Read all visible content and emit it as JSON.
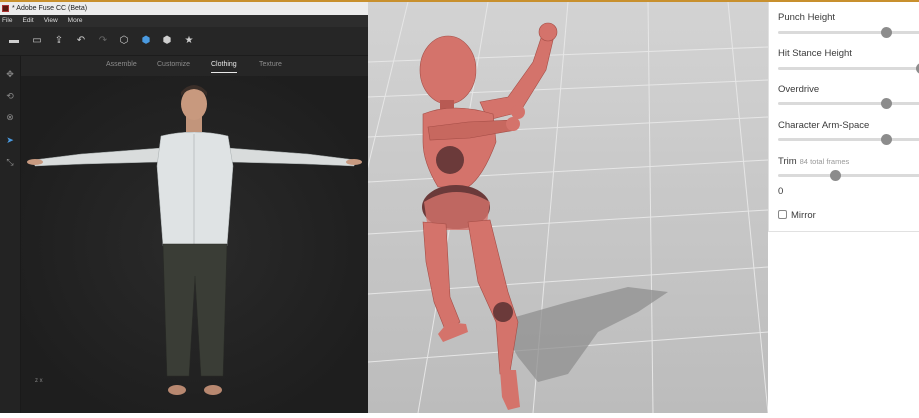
{
  "fuse_window": {
    "title": "* Adobe Fuse CC (Beta)",
    "menu": [
      "File",
      "Edit",
      "View",
      "More"
    ],
    "toolbar_icons": [
      "import-icon",
      "export-icon",
      "upload-icon",
      "undo-icon",
      "redo-icon",
      "cube-icon",
      "cube-solid-icon",
      "cube-textured-icon",
      "star-icon"
    ],
    "left_tools": [
      "move-icon",
      "rotate-icon",
      "orbit-icon",
      "select-icon",
      "scale-icon"
    ],
    "tabs": [
      "Assemble",
      "Customize",
      "Clothing",
      "Texture"
    ],
    "active_tab": "Clothing",
    "axis_label": "z  x"
  },
  "animation_settings": {
    "params": [
      {
        "label": "Punch Height",
        "value": 0.75
      },
      {
        "label": "Hit Stance Height",
        "value": 0.99
      },
      {
        "label": "Overdrive",
        "value": 0.75
      },
      {
        "label": "Character Arm-Space",
        "value": 0.75
      }
    ],
    "trim": {
      "label": "Trim",
      "sublabel": "84 total frames",
      "start": 0,
      "start_fraction": 0.4
    },
    "mirror": {
      "label": "Mirror",
      "checked": false
    }
  },
  "colors": {
    "model_skin": "#d4736b",
    "model_joint": "#6b3a3a",
    "floor": "#cfcfcf",
    "slider_thumb": "#8c8c8c"
  }
}
